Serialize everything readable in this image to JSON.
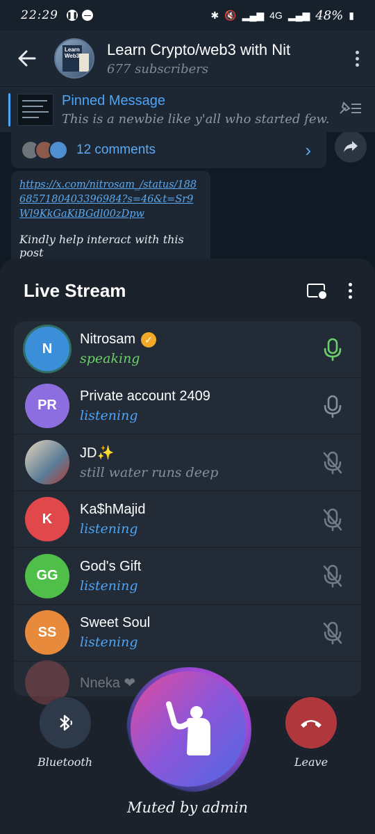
{
  "status_bar": {
    "time": "22:29",
    "network": "4G",
    "battery": "48%"
  },
  "channel": {
    "title": "Learn Crypto/web3 with Nit",
    "subscribers": "677 subscribers",
    "avatar_text": "Learn Web3"
  },
  "pinned": {
    "title": "Pinned Message",
    "text": "This is a newbie like y'all who started few..."
  },
  "post": {
    "comments": "12 comments",
    "link": "https://x.com/nitrosam_/status/1886857180403396984?s=46&t=Sr9Wl9KkGaKiBGdl00zDpw",
    "text": "Kindly help interact with this post"
  },
  "live_stream": {
    "title": "Live Stream",
    "participants": [
      {
        "initials": "N",
        "name": "Nitrosam",
        "status": "speaking",
        "status_type": "speaking",
        "avatar_color": "#3a8fd8",
        "mic": "active"
      },
      {
        "initials": "PR",
        "name": "Private account 2409",
        "status": "listening",
        "status_type": "listening",
        "avatar_color": "#8c6ee0",
        "mic": "on"
      },
      {
        "initials": "",
        "name": "JD✨",
        "status": "still water runs deep",
        "status_type": "about",
        "avatar_color": "#c9a98a",
        "mic": "muted"
      },
      {
        "initials": "K",
        "name": "Ka$hMajid",
        "status": "listening",
        "status_type": "listening",
        "avatar_color": "#e0484c",
        "mic": "muted"
      },
      {
        "initials": "GG",
        "name": "God's Gift",
        "status": "listening",
        "status_type": "listening",
        "avatar_color": "#4fbf4a",
        "mic": "muted"
      },
      {
        "initials": "SS",
        "name": "Sweet Soul",
        "status": "listening",
        "status_type": "listening",
        "avatar_color": "#e88a3c",
        "mic": "muted"
      }
    ],
    "partial_participant": "Nneka ❤"
  },
  "controls": {
    "bluetooth_label": "Bluetooth",
    "leave_label": "Leave",
    "muted_label": "Muted by admin"
  }
}
